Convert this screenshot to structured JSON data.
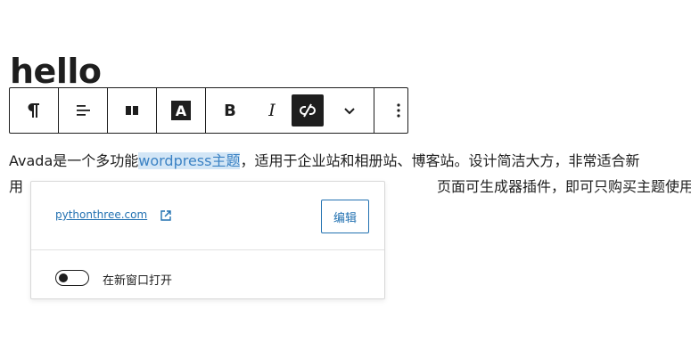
{
  "editor": {
    "heading": "hello",
    "paragraph": {
      "line1_before": "Avada是一个多功能",
      "line1_link": "wordpress主题",
      "line1_after": "，适用于企业站和相册站、博客站。设计简洁大方，非常适合新",
      "line2": "用　　　　　　　　　　　　　　　　　　　　　　　　　　　　　页面可生成器插件，即可只购买主题使用，也可以配合其它的"
    }
  },
  "toolbar": {
    "buttons": [
      {
        "name": "paragraph-icon"
      },
      {
        "name": "align-left-icon"
      },
      {
        "name": "columns-icon"
      },
      {
        "name": "text-color-icon"
      },
      {
        "name": "bold-icon"
      },
      {
        "name": "italic-icon"
      },
      {
        "name": "unlink-icon"
      },
      {
        "name": "chevron-down-icon"
      },
      {
        "name": "more-vertical-icon"
      }
    ],
    "text_color_glyph": "A",
    "bold_glyph": "B",
    "italic_glyph": "I"
  },
  "link_popover": {
    "url": "pythonthree.com",
    "edit_label": "编辑",
    "new_tab_label": "在新窗口打开",
    "new_tab_enabled": false
  },
  "colors": {
    "link": "#2271b1",
    "selection": "#d3e6f6",
    "text": "#1e1e1e"
  }
}
